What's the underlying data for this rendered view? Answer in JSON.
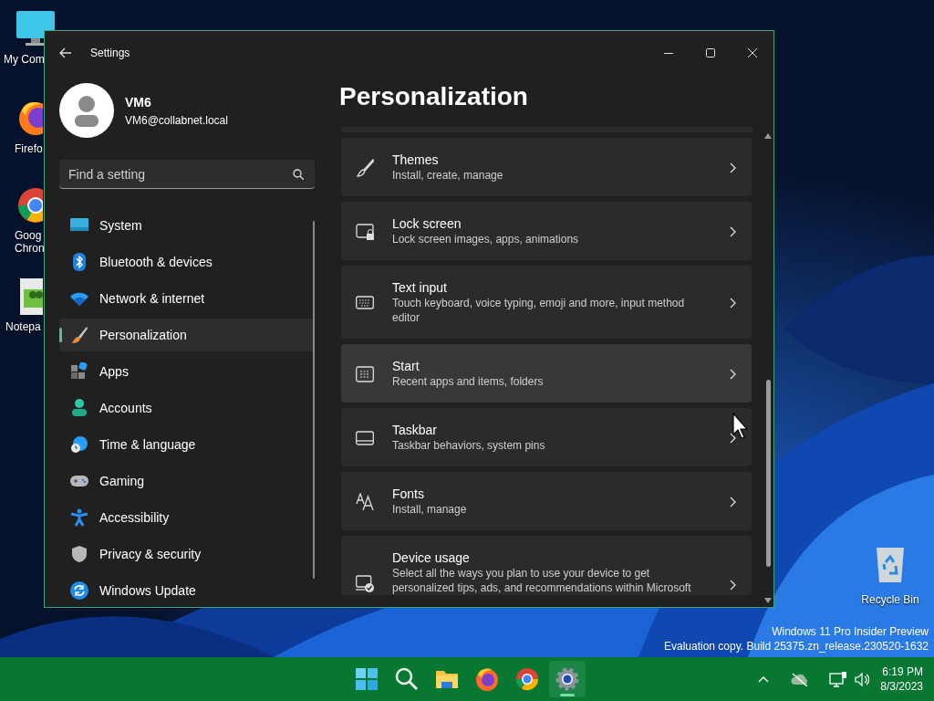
{
  "desktop": {
    "icons": [
      {
        "kind": "computer",
        "lines": [
          "My Com"
        ]
      },
      {
        "kind": "firefox",
        "lines": [
          "Firefo"
        ]
      },
      {
        "kind": "chrome",
        "lines": [
          "Goog",
          "Chron"
        ]
      },
      {
        "kind": "notepad",
        "lines": [
          "Notepa"
        ]
      }
    ],
    "recycle_bin": {
      "label": "Recycle Bin"
    },
    "build_info": [
      "Windows 11 Pro Insider Preview",
      "Evaluation copy. Build 25375.zn_release.230520-1632"
    ]
  },
  "window": {
    "title": "Settings",
    "user": {
      "name": "VM6",
      "email": "VM6@collabnet.local"
    },
    "search": {
      "placeholder": "Find a setting"
    },
    "nav": [
      {
        "label": "System",
        "selected": false
      },
      {
        "label": "Bluetooth & devices",
        "selected": false
      },
      {
        "label": "Network & internet",
        "selected": false
      },
      {
        "label": "Personalization",
        "selected": true
      },
      {
        "label": "Apps",
        "selected": false
      },
      {
        "label": "Accounts",
        "selected": false
      },
      {
        "label": "Time & language",
        "selected": false
      },
      {
        "label": "Gaming",
        "selected": false
      },
      {
        "label": "Accessibility",
        "selected": false
      },
      {
        "label": "Privacy & security",
        "selected": false
      },
      {
        "label": "Windows Update",
        "selected": false
      }
    ],
    "page_title": "Personalization",
    "items": [
      {
        "kind": "themes",
        "title": "Themes",
        "subtitle": "Install, create, manage",
        "hovered": false
      },
      {
        "kind": "lock",
        "title": "Lock screen",
        "subtitle": "Lock screen images, apps, animations",
        "hovered": false
      },
      {
        "kind": "keyboard",
        "title": "Text input",
        "subtitle": "Touch keyboard, voice typing, emoji and more, input method editor",
        "hovered": false
      },
      {
        "kind": "start",
        "title": "Start",
        "subtitle": "Recent apps and items, folders",
        "hovered": true
      },
      {
        "kind": "taskbar",
        "title": "Taskbar",
        "subtitle": "Taskbar behaviors, system pins",
        "hovered": false
      },
      {
        "kind": "fonts",
        "title": "Fonts",
        "subtitle": "Install, manage",
        "hovered": false
      },
      {
        "kind": "device",
        "title": "Device usage",
        "subtitle": "Select all the ways you plan to use your device to get personalized tips, ads, and recommendations within Microsoft",
        "hovered": false
      }
    ]
  },
  "taskbar": {
    "apps": [
      {
        "kind": "start",
        "selected": false
      },
      {
        "kind": "search",
        "selected": false
      },
      {
        "kind": "explorer",
        "selected": false
      },
      {
        "kind": "firefox",
        "selected": false
      },
      {
        "kind": "chrome",
        "selected": false
      },
      {
        "kind": "settings",
        "selected": true
      }
    ],
    "clock": {
      "time": "6:19 PM",
      "date": "8/3/2023"
    }
  }
}
